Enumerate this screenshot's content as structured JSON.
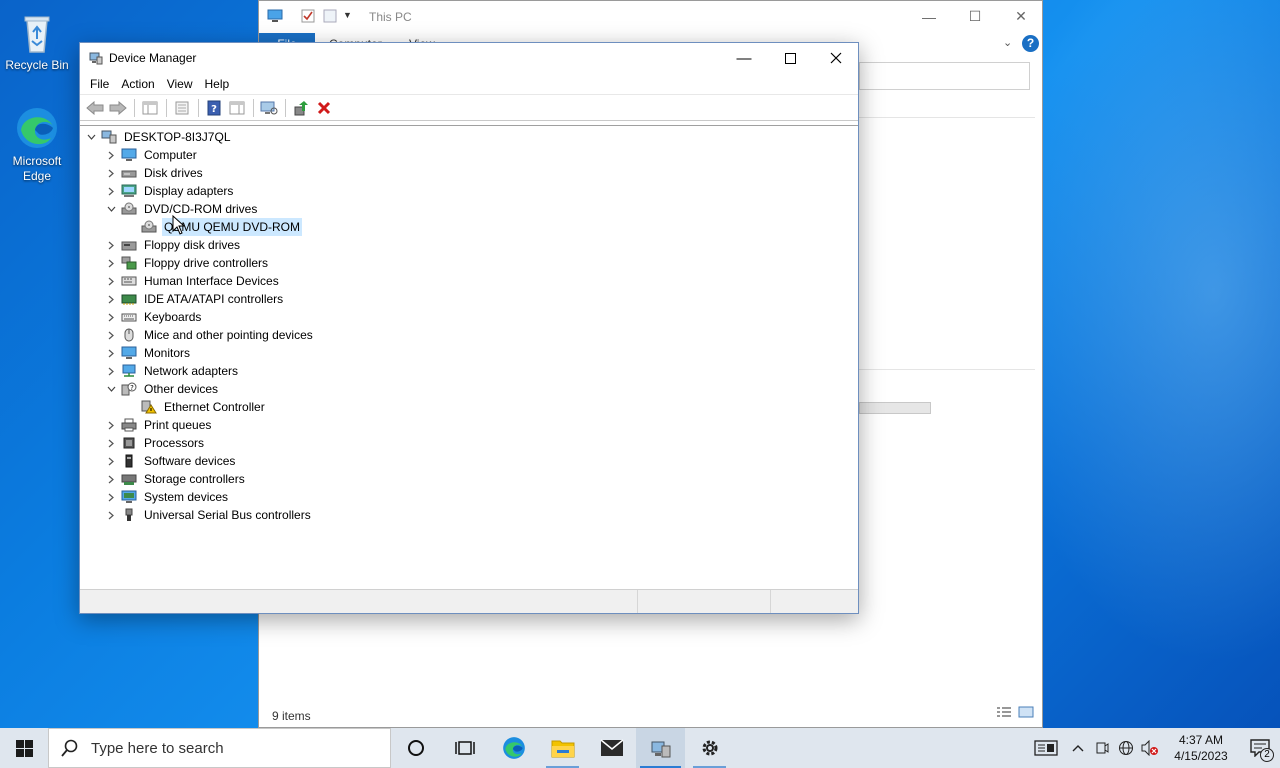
{
  "desktop": {
    "icons": [
      {
        "label": "Recycle Bin"
      },
      {
        "label": "Microsoft Edge"
      }
    ]
  },
  "explorer": {
    "title": "This PC",
    "tabs": [
      "File",
      "Computer",
      "View"
    ],
    "status": "9 items"
  },
  "devmgr": {
    "title": "Device Manager",
    "menu": [
      "File",
      "Action",
      "View",
      "Help"
    ],
    "tree": [
      {
        "label": "DESKTOP-8I3J7QL",
        "level": 0,
        "expander": "expanded",
        "icon": "computer-root-icon"
      },
      {
        "label": "Computer",
        "level": 1,
        "expander": "collapsed",
        "icon": "monitor-icon"
      },
      {
        "label": "Disk drives",
        "level": 1,
        "expander": "collapsed",
        "icon": "disk-drive-icon"
      },
      {
        "label": "Display adapters",
        "level": 1,
        "expander": "collapsed",
        "icon": "display-adapter-icon"
      },
      {
        "label": "DVD/CD-ROM drives",
        "level": 1,
        "expander": "expanded",
        "icon": "dvd-drive-icon"
      },
      {
        "label": "QEMU QEMU DVD-ROM",
        "level": 2,
        "expander": "none",
        "icon": "dvd-drive-icon",
        "selected": true
      },
      {
        "label": "Floppy disk drives",
        "level": 1,
        "expander": "collapsed",
        "icon": "floppy-icon"
      },
      {
        "label": "Floppy drive controllers",
        "level": 1,
        "expander": "collapsed",
        "icon": "controller-icon"
      },
      {
        "label": "Human Interface Devices",
        "level": 1,
        "expander": "collapsed",
        "icon": "hid-icon"
      },
      {
        "label": "IDE ATA/ATAPI controllers",
        "level": 1,
        "expander": "collapsed",
        "icon": "ide-controller-icon"
      },
      {
        "label": "Keyboards",
        "level": 1,
        "expander": "collapsed",
        "icon": "keyboard-icon"
      },
      {
        "label": "Mice and other pointing devices",
        "level": 1,
        "expander": "collapsed",
        "icon": "mouse-icon"
      },
      {
        "label": "Monitors",
        "level": 1,
        "expander": "collapsed",
        "icon": "monitor-icon"
      },
      {
        "label": "Network adapters",
        "level": 1,
        "expander": "collapsed",
        "icon": "network-adapter-icon"
      },
      {
        "label": "Other devices",
        "level": 1,
        "expander": "expanded",
        "icon": "unknown-device-icon"
      },
      {
        "label": "Ethernet Controller",
        "level": 2,
        "expander": "none",
        "icon": "warning-device-icon"
      },
      {
        "label": "Print queues",
        "level": 1,
        "expander": "collapsed",
        "icon": "printer-icon"
      },
      {
        "label": "Processors",
        "level": 1,
        "expander": "collapsed",
        "icon": "processor-icon"
      },
      {
        "label": "Software devices",
        "level": 1,
        "expander": "collapsed",
        "icon": "software-device-icon"
      },
      {
        "label": "Storage controllers",
        "level": 1,
        "expander": "collapsed",
        "icon": "storage-controller-icon"
      },
      {
        "label": "System devices",
        "level": 1,
        "expander": "collapsed",
        "icon": "system-device-icon"
      },
      {
        "label": "Universal Serial Bus controllers",
        "level": 1,
        "expander": "collapsed",
        "icon": "usb-icon"
      }
    ]
  },
  "taskbar": {
    "search_placeholder": "Type here to search",
    "time": "4:37 AM",
    "date": "4/15/2023",
    "notification_count": "2"
  },
  "colors": {
    "accent": "#1a6fc4",
    "selection": "#cce8ff",
    "delete_red": "#d11a1a"
  }
}
